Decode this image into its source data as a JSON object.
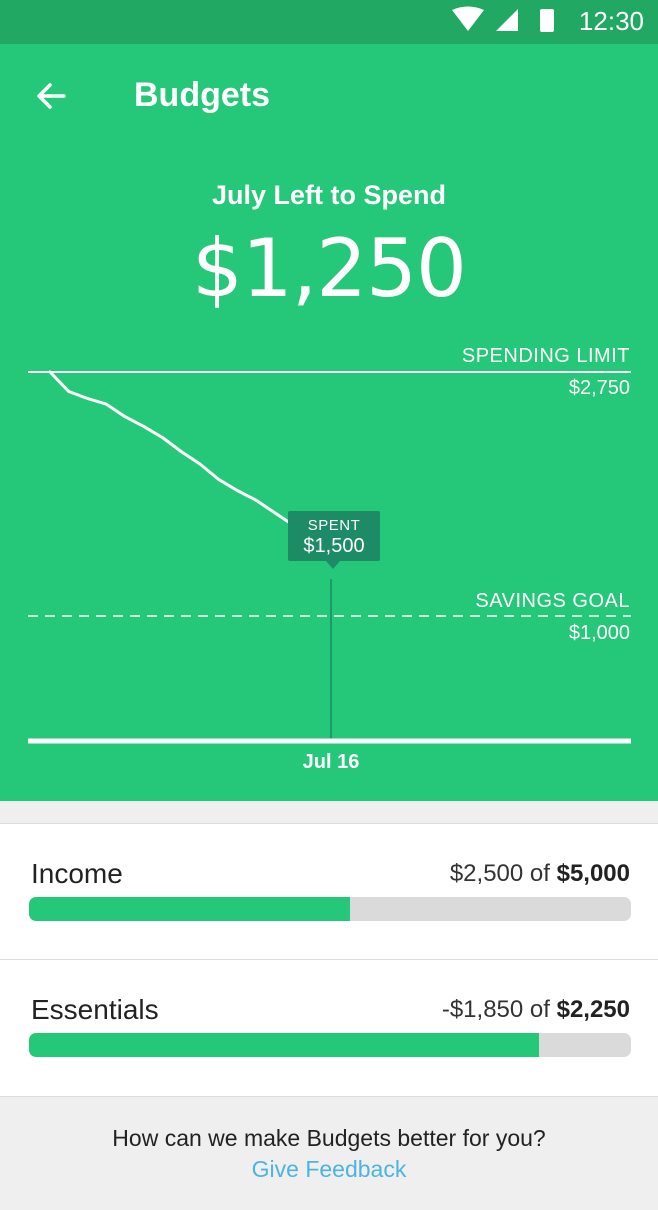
{
  "status_bar": {
    "time": "12:30",
    "icons": [
      "wifi-icon",
      "signal-icon",
      "battery-icon"
    ]
  },
  "header": {
    "title": "Budgets",
    "back_icon": "arrow-left-icon"
  },
  "summary": {
    "label": "July Left to Spend",
    "amount": "$1,250"
  },
  "chart": {
    "spending_limit_label": "SPENDING LIMIT",
    "spending_limit_value": "$2,750",
    "savings_goal_label": "SAVINGS GOAL",
    "savings_goal_value": "$1,000",
    "spent_label": "SPENT",
    "spent_value": "$1,500",
    "current_date_label": "Jul 16"
  },
  "chart_data": {
    "type": "line",
    "title": "",
    "xlabel": "",
    "ylabel": "",
    "x_tick_labels": [
      "Jul 16"
    ],
    "reference_lines": [
      {
        "name": "SPENDING LIMIT",
        "value": 2750,
        "style": "solid"
      },
      {
        "name": "SAVINGS GOAL",
        "value": 1000,
        "style": "dashed"
      }
    ],
    "highlight": {
      "label": "SPENT",
      "x": "Jul 16",
      "y": 1500
    },
    "x": [
      1,
      2,
      3,
      4,
      5,
      6,
      7,
      8,
      9,
      10,
      11,
      12,
      13,
      14,
      15,
      16
    ],
    "series": [
      {
        "values": [
          2750,
          2610,
          2560,
          2520,
          2430,
          2360,
          2280,
          2180,
          2090,
          1980,
          1900,
          1830,
          1740,
          1650,
          1560,
          1500
        ]
      }
    ],
    "grid": false
  },
  "budgets": [
    {
      "name": "Income",
      "value_text": "$2,500 of ",
      "total_text": "$5,000",
      "progress": 0.533
    },
    {
      "name": "Essentials",
      "value_text": "-$1,850 of ",
      "total_text": "$2,250",
      "progress": 0.848
    }
  ],
  "footer": {
    "question": "How can we make Budgets better for you?",
    "link": "Give Feedback"
  },
  "colors": {
    "primary": "#25c778",
    "status_bar": "#21a863",
    "tooltip": "#1d8c66",
    "link": "#4fb3e0",
    "track": "#dadada"
  }
}
